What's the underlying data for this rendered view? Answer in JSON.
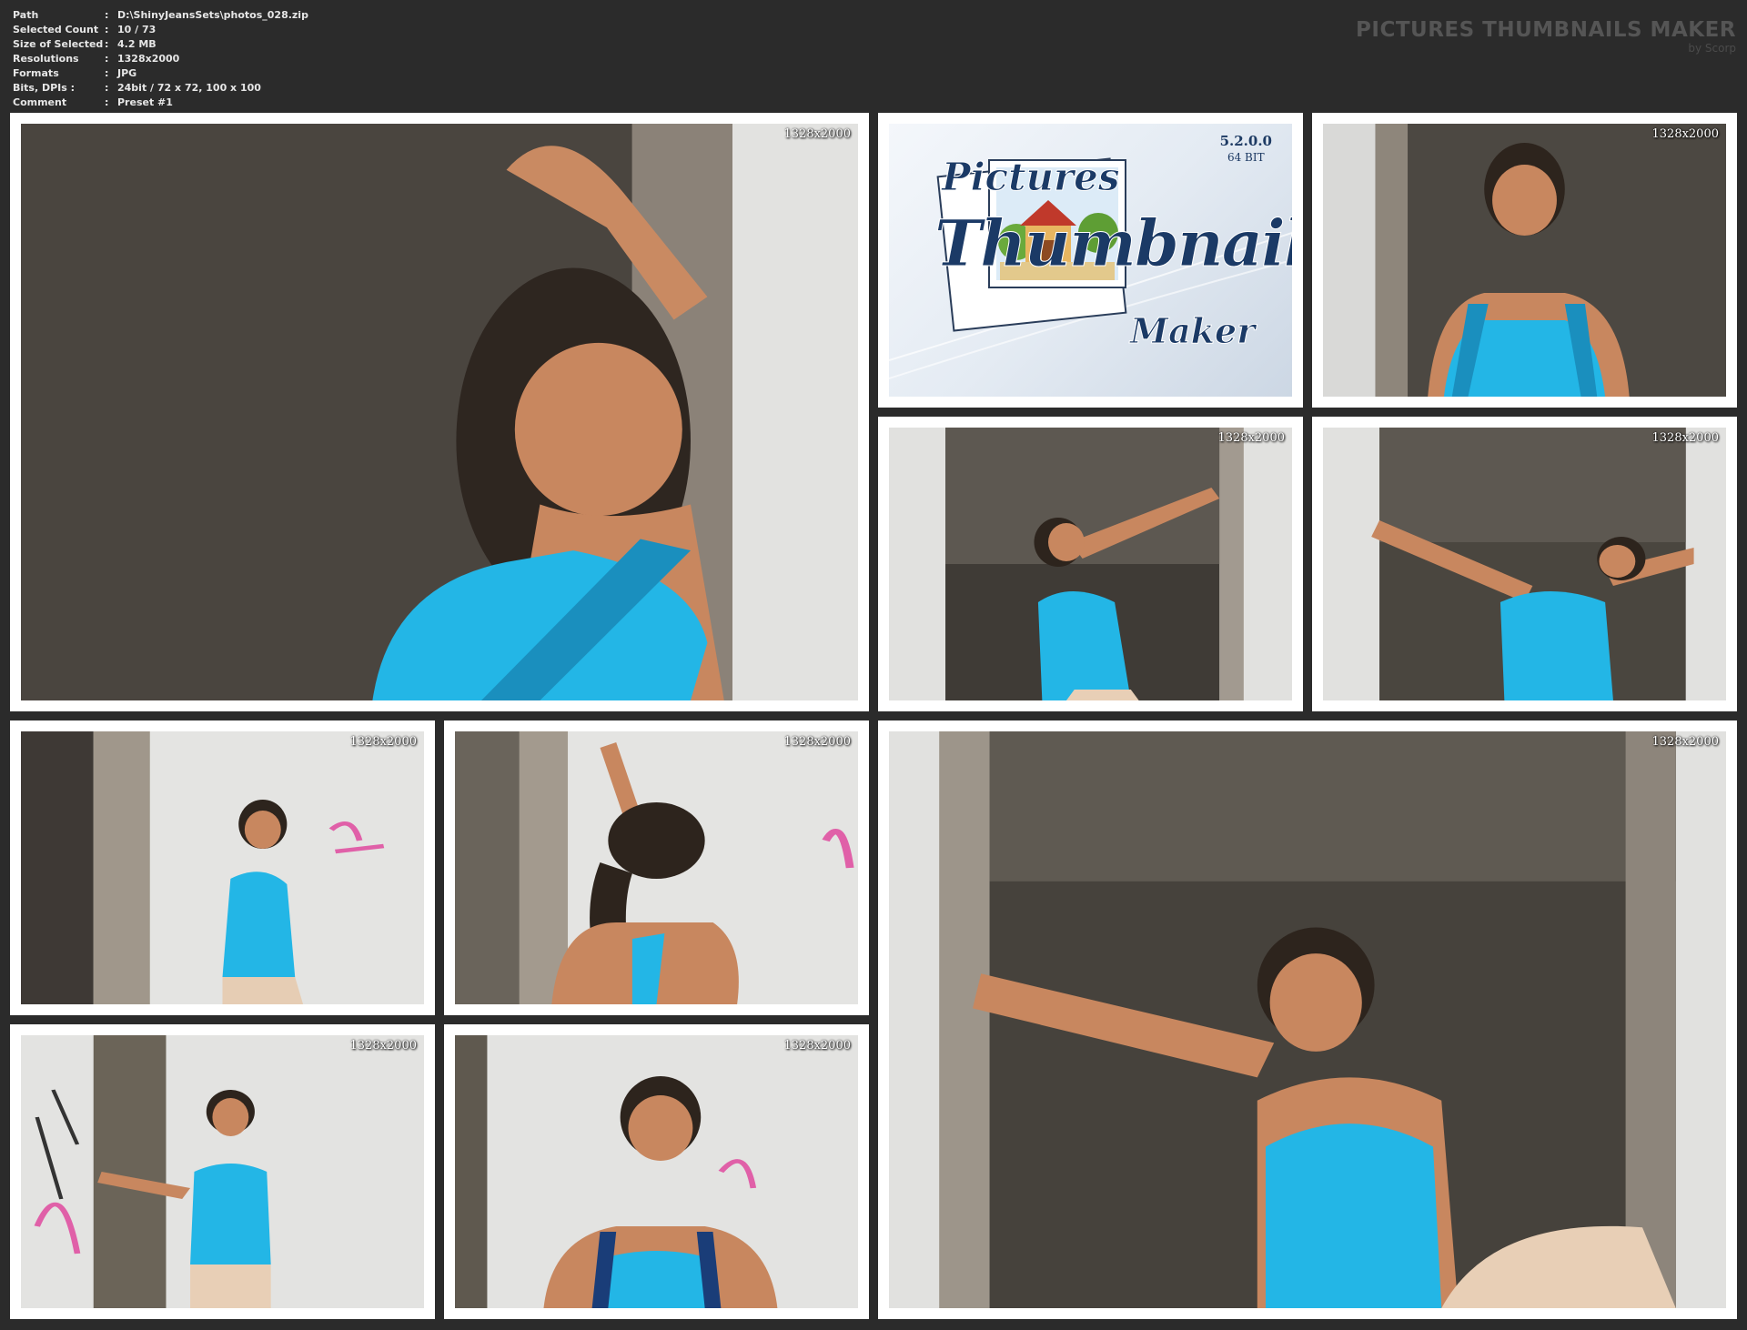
{
  "info": [
    {
      "label": "Path",
      "value": "D:\\ShinyJeansSets\\photos_028.zip"
    },
    {
      "label": "Selected Count",
      "value": "10 / 73"
    },
    {
      "label": "Size of Selected",
      "value": "4.2 MB"
    },
    {
      "label": "Resolutions",
      "value": "1328x2000"
    },
    {
      "label": "Formats",
      "value": "JPG"
    },
    {
      "label": "Bits, DPIs :",
      "value": "24bit / 72 x 72, 100 x 100"
    },
    {
      "label": "Comment",
      "value": "Preset #1"
    }
  ],
  "brand": {
    "title": "PICTURES THUMBNAILS MAKER",
    "by": "by Scorp"
  },
  "separator": ":",
  "resolution_label": "1328x2000",
  "logo": {
    "version": "5.2.0.0",
    "bits": "64 BIT",
    "word1": "Pictures",
    "word2": "Thumbnails",
    "word3": "Maker"
  },
  "colors": {
    "background": "#2b2b2b",
    "swimsuit": "#23b6e6",
    "wall": "#e4e4e2",
    "doorway": "#4c4842",
    "skin": "#c8875f"
  }
}
